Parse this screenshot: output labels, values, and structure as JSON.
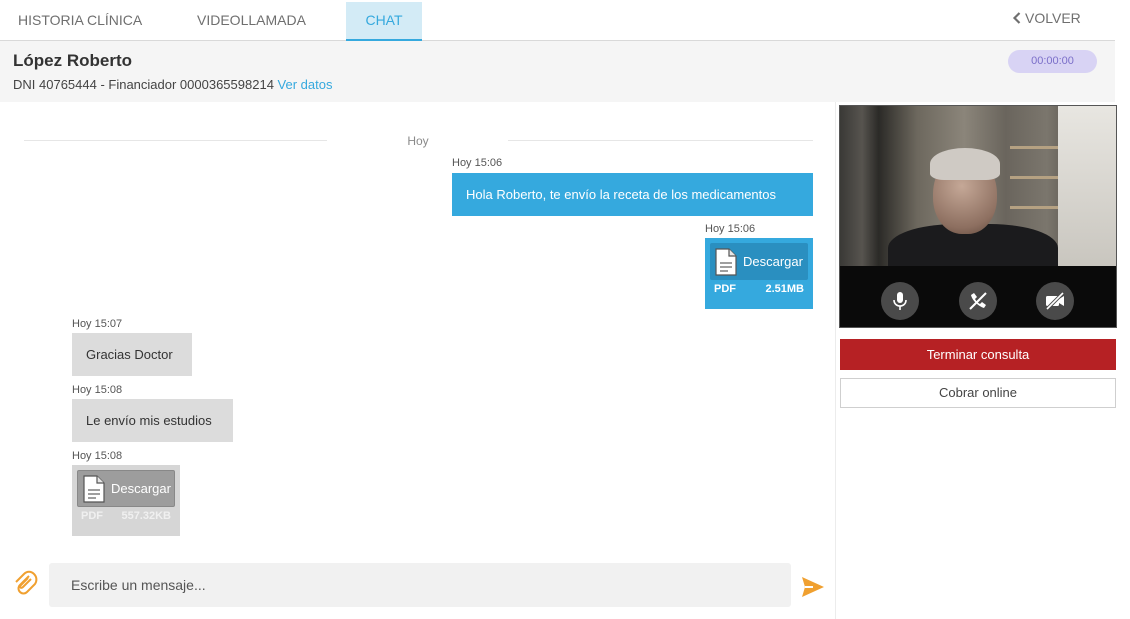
{
  "tabs": [
    {
      "label": "HISTORIA CLÍNICA",
      "active": false
    },
    {
      "label": "VIDEOLLAMADA",
      "active": false
    },
    {
      "label": "CHAT",
      "active": true
    }
  ],
  "back_label": "VOLVER",
  "patient": {
    "name": "López Roberto",
    "info": "DNI 40765444 - Financiador 0000365598214",
    "link": "Ver datos",
    "timer": "00:00:00"
  },
  "chat": {
    "day": "Hoy",
    "messages": [
      {
        "time": "Hoy 15:06",
        "text": "Hola Roberto, te envío la receta de los medicamentos",
        "from": "doctor"
      },
      {
        "time": "Hoy 15:06",
        "file": {
          "action": "Descargar",
          "type": "PDF",
          "size": "2.51MB"
        },
        "from": "doctor"
      },
      {
        "time": "Hoy 15:07",
        "text": "Gracias Doctor",
        "from": "patient"
      },
      {
        "time": "Hoy 15:08",
        "text": "Le envío mis estudios",
        "from": "patient"
      },
      {
        "time": "Hoy 15:08",
        "file": {
          "action": "Descargar",
          "type": "PDF",
          "size": "557.32KB"
        },
        "from": "patient"
      }
    ],
    "input_placeholder": "Escribe un mensaje..."
  },
  "actions": {
    "end": "Terminar consulta",
    "pay": "Cobrar online"
  },
  "colors": {
    "accent": "#35a9de",
    "danger": "#b62124",
    "timer_bg": "#d8d3f4",
    "attach": "#f0a030"
  },
  "icons": [
    "chevron-left-icon",
    "attach-icon",
    "send-icon",
    "document-icon",
    "microphone-icon",
    "phone-off-icon",
    "video-off-icon"
  ]
}
